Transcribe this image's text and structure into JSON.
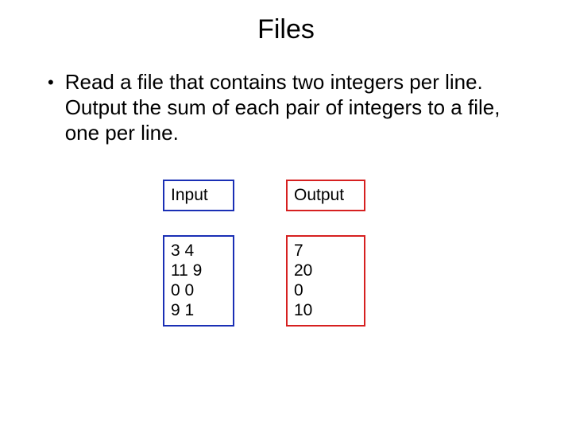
{
  "title": "Files",
  "bullet": "Read a file that contains two integers per line. Output the sum of each pair of integers to a file, one per line.",
  "input_label": "Input",
  "output_label": "Output",
  "input_lines": [
    "3 4",
    "11 9",
    "0 0",
    "9 1"
  ],
  "output_lines": [
    "7",
    "20",
    "0",
    "10"
  ],
  "colors": {
    "input_border": "#1a2fb5",
    "output_border": "#d62020"
  }
}
